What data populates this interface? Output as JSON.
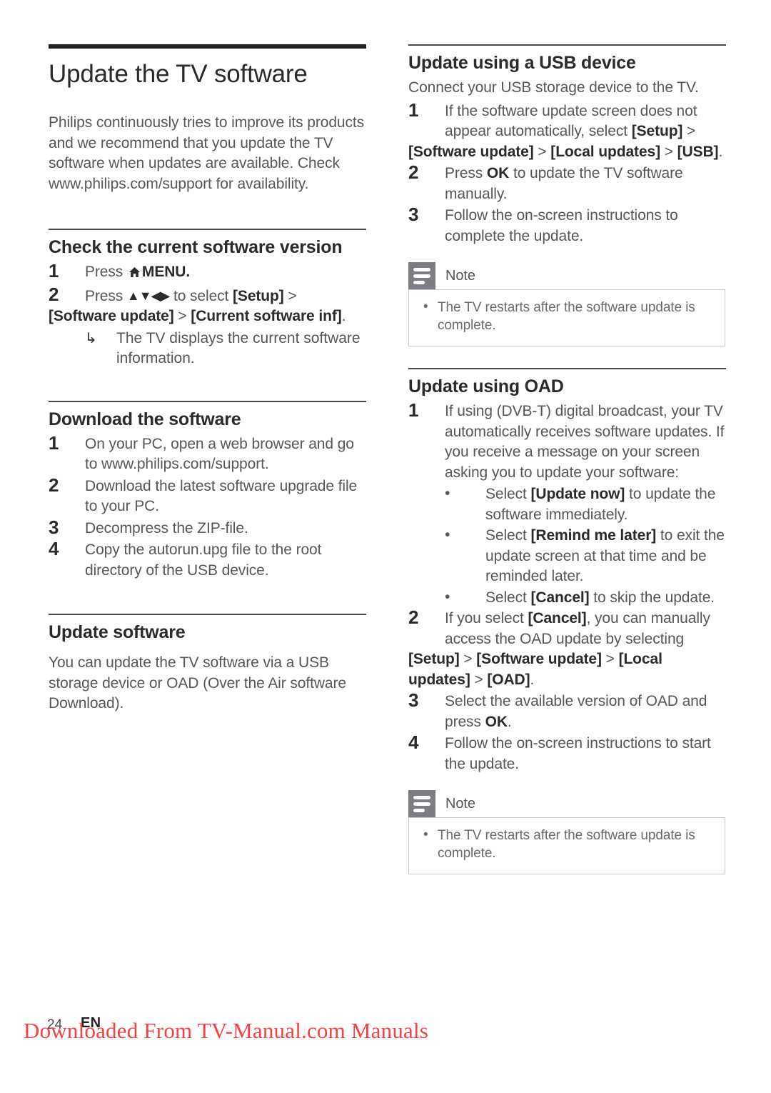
{
  "document": {
    "title": "Update the TV software",
    "intro": "Philips continuously tries to improve its products and we recommend that you update the TV software when updates are available. Check www.philips.com/support for availability."
  },
  "sections": {
    "check_version": {
      "heading": "Check the current software version",
      "step1_pre": "Press ",
      "step1_icon": "home-icon",
      "step1_post": "MENU.",
      "step2_pre": "Press ",
      "step2_arrows": "▲▼◀▶",
      "step2_mid": " to select ",
      "step2_b1": "[Setup]",
      "step2_sep": " > ",
      "step2_b2": "[Software update]",
      "step2_b3": "[Current software inf]",
      "step2_end": ".",
      "sub_arrow_glyph": "↳",
      "sub_arrow_text": "The TV displays the current software information."
    },
    "download": {
      "heading": "Download the software",
      "steps": [
        "On your PC, open a web browser and go to www.philips.com/support.",
        "Download the latest software upgrade file to your PC.",
        "Decompress the ZIP-file.",
        "Copy the autorun.upg file to the root directory of the USB device."
      ]
    },
    "update_software": {
      "heading": "Update software",
      "paragraph": "You can update the TV software via a USB storage device or OAD (Over the Air software Download)."
    },
    "usb": {
      "heading": "Update using a USB device",
      "intro": "Connect your USB storage device to the TV.",
      "step1_pre": "If the software update screen does not appear automatically, select ",
      "step1_b1": "[Setup]",
      "step1_sep": " > ",
      "step1_b2": "[Software update]",
      "step1_b3": "[Local updates]",
      "step1_b4": "[USB]",
      "step1_end": ".",
      "step2_pre": "Press ",
      "step2_key": "OK",
      "step2_post": " to update the TV software manually.",
      "step3": "Follow the on-screen instructions to complete the update.",
      "note": {
        "title": "Note",
        "items": [
          "The TV restarts after the software update is complete."
        ]
      }
    },
    "oad": {
      "heading": "Update using OAD",
      "step1": "If using (DVB-T) digital broadcast, your TV automatically receives software updates. If you receive a message on your screen asking you to update your software:",
      "bullets": [
        {
          "pre": "Select ",
          "bold": "[Update now]",
          "post": " to update the software immediately."
        },
        {
          "pre": "Select ",
          "bold": "[Remind me later]",
          "post": " to exit the update screen at that time and be reminded later."
        },
        {
          "pre": "Select ",
          "bold": "[Cancel]",
          "post": " to skip the update."
        }
      ],
      "step2_pre": "If you select ",
      "step2_b0": "[Cancel]",
      "step2_mid": ", you can manually access the OAD update by selecting ",
      "step2_b1": "[Setup]",
      "step2_sep": " > ",
      "step2_b2": "[Software update]",
      "step2_b3": "[Local updates]",
      "step2_b4": "[OAD]",
      "step2_end": ".",
      "step3_pre": "Select the available version of OAD and press ",
      "step3_key": "OK",
      "step3_end": ".",
      "step4": "Follow the on-screen instructions to start the update.",
      "note": {
        "title": "Note",
        "items": [
          "The TV restarts after the software update is complete."
        ]
      }
    }
  },
  "footer": {
    "page_number": "24",
    "language": "EN",
    "watermark": "Downloaded From TV-Manual.com Manuals"
  },
  "numerals": {
    "n1": "1",
    "n2": "2",
    "n3": "3",
    "n4": "4"
  },
  "colors": {
    "text": "#58585b",
    "heading": "#2b2b2e",
    "note_tab": "#7c7c82",
    "note_border": "#c9c9ce",
    "watermark": "#fc4040"
  }
}
